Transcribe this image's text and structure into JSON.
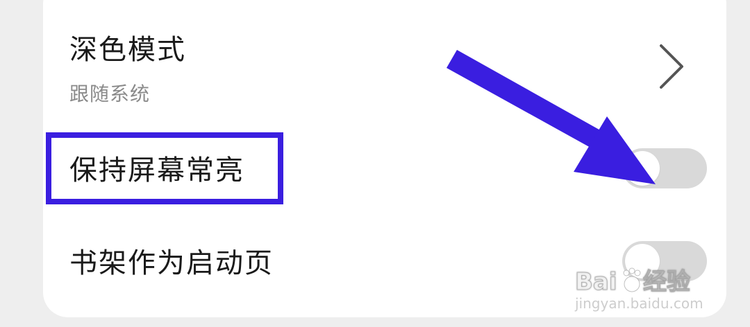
{
  "settings": {
    "dark_mode": {
      "label": "深色模式",
      "value": "跟随系统"
    },
    "keep_screen_on": {
      "label": "保持屏幕常亮",
      "enabled": false
    },
    "bookshelf_startup": {
      "label": "书架作为启动页",
      "enabled": false
    }
  },
  "annotation": {
    "highlight_color": "#3a1ee0",
    "arrow_color": "#3a1ee0"
  },
  "watermark": {
    "brand": "Baidu经验",
    "domain": "jingyan.baidu.com"
  }
}
